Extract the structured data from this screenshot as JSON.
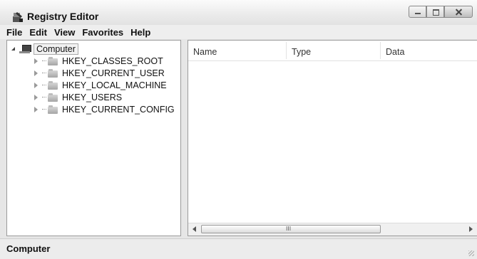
{
  "window": {
    "title": "Registry Editor",
    "app_icon": "registry-editor-icon"
  },
  "menu": [
    "File",
    "Edit",
    "View",
    "Favorites",
    "Help"
  ],
  "tree": {
    "root": {
      "label": "Computer",
      "icon": "computer-icon",
      "expanded": true
    },
    "hives": [
      {
        "label": "HKEY_CLASSES_ROOT",
        "icon": "folder-icon"
      },
      {
        "label": "HKEY_CURRENT_USER",
        "icon": "folder-icon"
      },
      {
        "label": "HKEY_LOCAL_MACHINE",
        "icon": "folder-icon"
      },
      {
        "label": "HKEY_USERS",
        "icon": "folder-icon"
      },
      {
        "label": "HKEY_CURRENT_CONFIG",
        "icon": "folder-icon"
      }
    ]
  },
  "list": {
    "columns": [
      "Name",
      "Type",
      "Data"
    ],
    "scroll_grip": "III"
  },
  "status": {
    "text": "Computer"
  }
}
